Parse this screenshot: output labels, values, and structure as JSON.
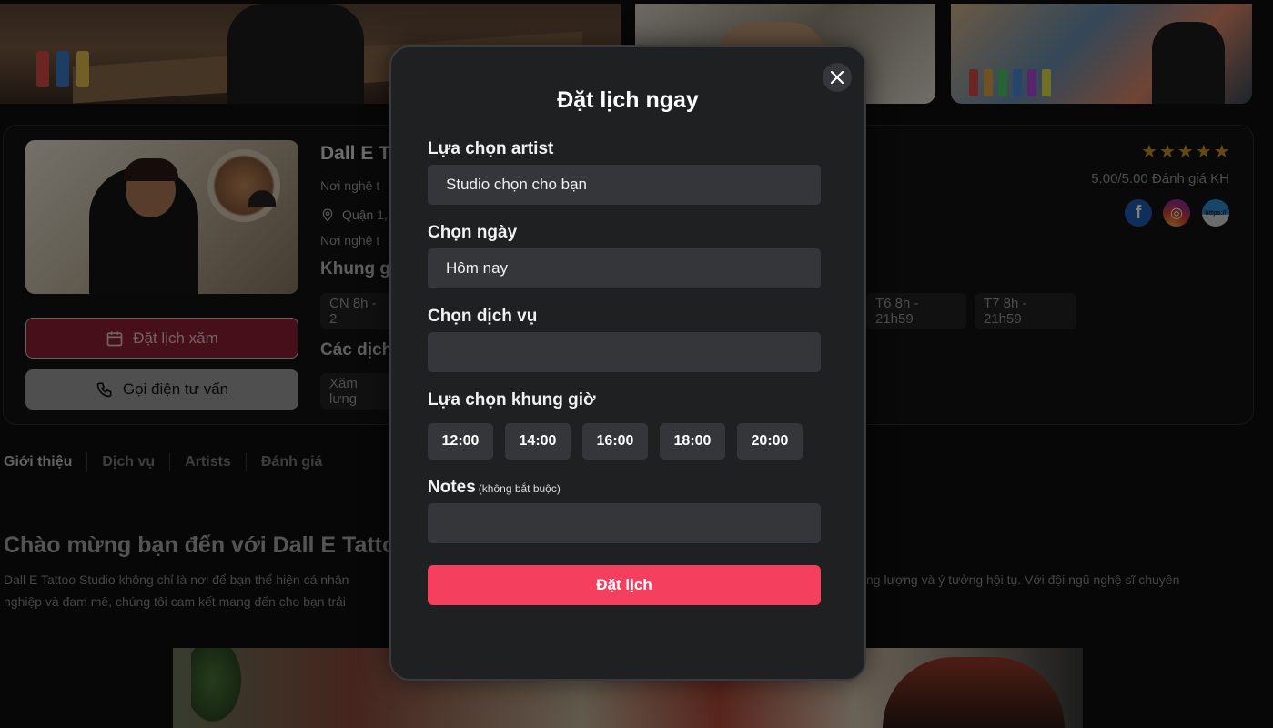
{
  "studio": {
    "name": "Dall E T",
    "line1": "Nơi nghệ t",
    "location": "Quận 1,",
    "line3": "Nơi nghệ t",
    "hours_heading": "Khung g",
    "services_heading": "Các dịch",
    "hours": [
      "CN 8h - 2",
      "T6 8h - 21h59",
      "T7 8h - 21h59"
    ],
    "service_chip": "Xăm lưng",
    "rating_text": "5.00/5.00 Đánh giá KH",
    "stars": 5,
    "social": [
      {
        "name": "facebook",
        "glyph": "f"
      },
      {
        "name": "instagram",
        "glyph": "◎"
      },
      {
        "name": "website",
        "glyph": "https://"
      }
    ]
  },
  "actions": {
    "book_label": "Đặt lịch xăm",
    "call_label": "Gọi điện tư vấn"
  },
  "tabs": [
    "Giới thiệu",
    "Dịch vụ",
    "Artists",
    "Đánh giá"
  ],
  "intro": {
    "heading": "Chào mừng bạn đến với Dall E Tattoo",
    "p1_left": "Dall E Tattoo Studio không chỉ là nơi để bạn thể hiện cá nhân",
    "p1_right": "ng lượng và ý tưởng hội tụ. Với đội ngũ nghệ sĩ chuyên",
    "p2_left": "nghiệp và đam mê, chúng tôi cam kết mang đến cho bạn trải",
    "p3_left": ""
  },
  "modal": {
    "title": "Đặt lịch ngay",
    "artist_label": "Lựa chọn artist",
    "artist_value": "Studio chọn cho bạn",
    "date_label": "Chọn ngày",
    "date_value": "Hôm nay",
    "service_label": "Chọn dịch vụ",
    "service_value": "",
    "time_label": "Lựa chọn khung giờ",
    "times": [
      "12:00",
      "14:00",
      "16:00",
      "18:00",
      "20:00"
    ],
    "notes_label": "Notes",
    "notes_hint": "(không bắt buộc)",
    "notes_value": "",
    "submit_label": "Đặt lịch"
  },
  "colors": {
    "accent": "#f43f5e",
    "book_button": "#8e1f33",
    "modal_bg": "#1f2022",
    "field_bg": "#35363a",
    "star": "#c9932b"
  }
}
